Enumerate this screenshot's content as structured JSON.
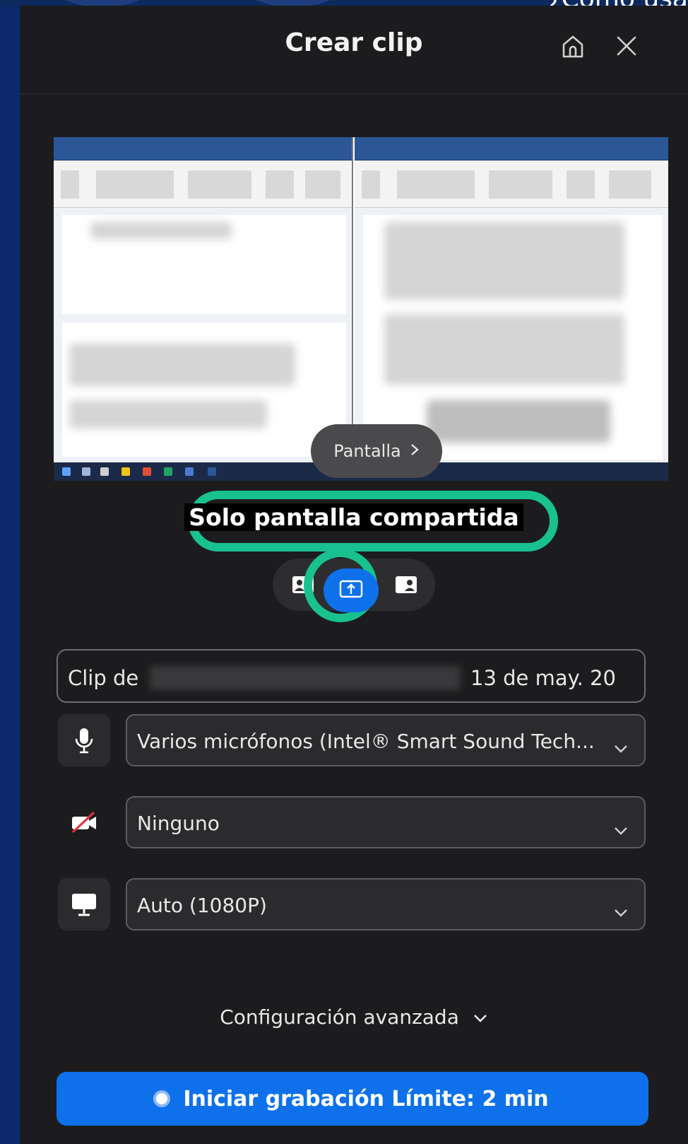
{
  "background": {
    "partial_text": "¿Cómo usa"
  },
  "header": {
    "title": "Crear clip"
  },
  "preview": {
    "source_button": "Pantalla"
  },
  "layout": {
    "selected_label": "Solo pantalla compartida"
  },
  "clip_name": {
    "prefix": "Clip de",
    "suffix": "13 de may. 20"
  },
  "microphone": {
    "value": "Varios micrófonos (Intel® Smart Sound Tech..."
  },
  "camera": {
    "value": "Ninguno"
  },
  "resolution": {
    "value": "Auto (1080P)"
  },
  "advanced": {
    "label": "Configuración avanzada"
  },
  "start_button": {
    "label": "Iniciar grabación Límite: 2 min"
  },
  "colors": {
    "accent": "#0e71eb",
    "highlight": "#19c18f",
    "panel": "#1c1c1e"
  }
}
